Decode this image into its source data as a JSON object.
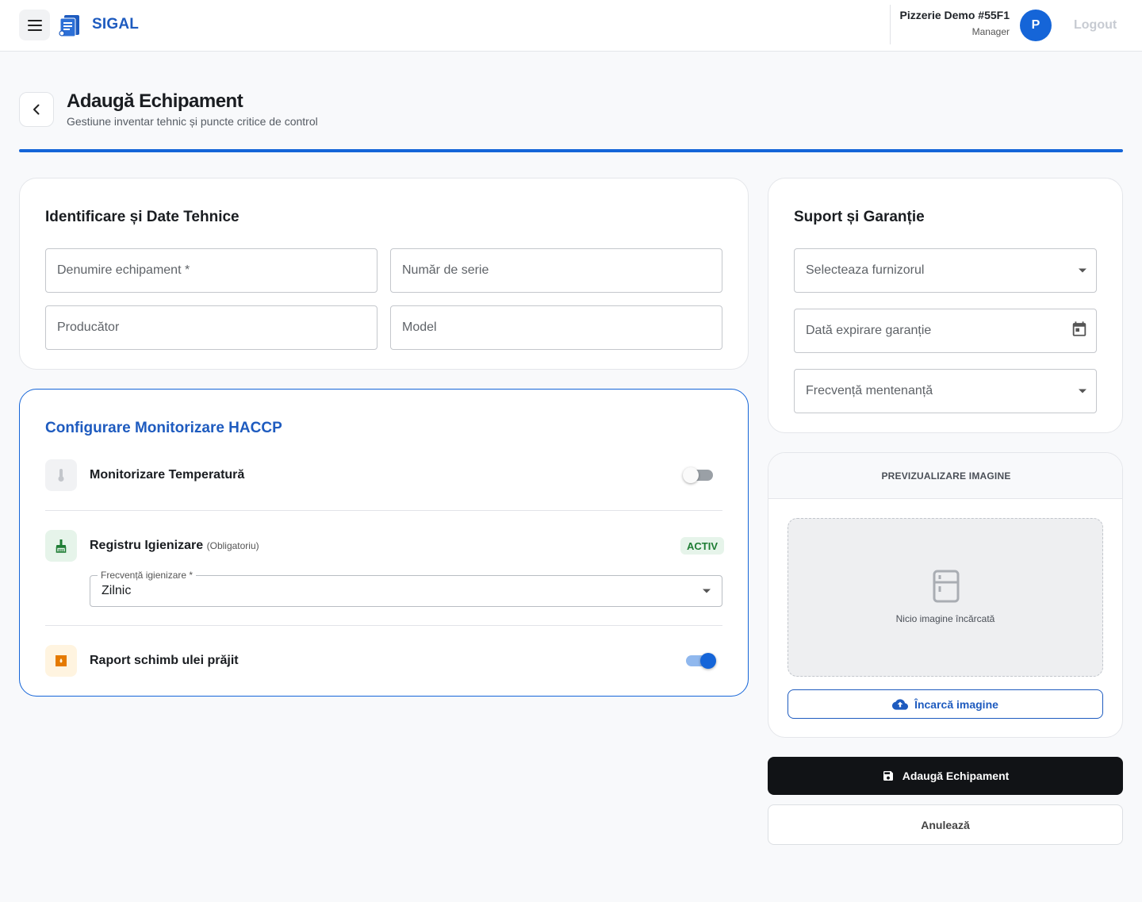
{
  "header": {
    "brand": "SIGAL",
    "location_name": "Pizzerie Demo #55F1",
    "role": "Manager",
    "avatar_initial": "P",
    "logout_label": "Logout"
  },
  "page": {
    "title": "Adaugă Echipament",
    "subtitle": "Gestiune inventar tehnic și puncte critice de control"
  },
  "identification": {
    "title": "Identificare și Date Tehnice",
    "fields": {
      "name_placeholder": "Denumire echipament *",
      "serial_placeholder": "Număr de serie",
      "manufacturer_placeholder": "Producător",
      "model_placeholder": "Model"
    }
  },
  "support": {
    "title": "Suport și Garanție",
    "supplier_placeholder": "Selecteaza furnizorul",
    "warranty_placeholder": "Dată expirare garanție",
    "maintenance_placeholder": "Frecvență mentenanță"
  },
  "haccp": {
    "title": "Configurare Monitorizare HACCP",
    "temperature": {
      "label": "Monitorizare Temperatură",
      "enabled": false
    },
    "hygiene": {
      "label": "Registru Igienizare",
      "note": "(Obligatoriu)",
      "badge": "ACTIV",
      "frequency_label": "Frecvență igienizare *",
      "frequency_value": "Zilnic"
    },
    "oil": {
      "label": "Raport schimb ulei prăjit",
      "enabled": true
    }
  },
  "preview": {
    "heading": "PREVIZUALIZARE IMAGINE",
    "empty_text": "Nicio imagine încărcată",
    "upload_label": "Încarcă imagine"
  },
  "actions": {
    "submit_label": "Adaugă Echipament",
    "cancel_label": "Anulează"
  },
  "colors": {
    "primary": "#1565d8",
    "brand_text": "#1e5bbf",
    "active_badge_bg": "#e6f4ea",
    "active_badge_text": "#1e7d34",
    "dark_button": "#111316"
  }
}
